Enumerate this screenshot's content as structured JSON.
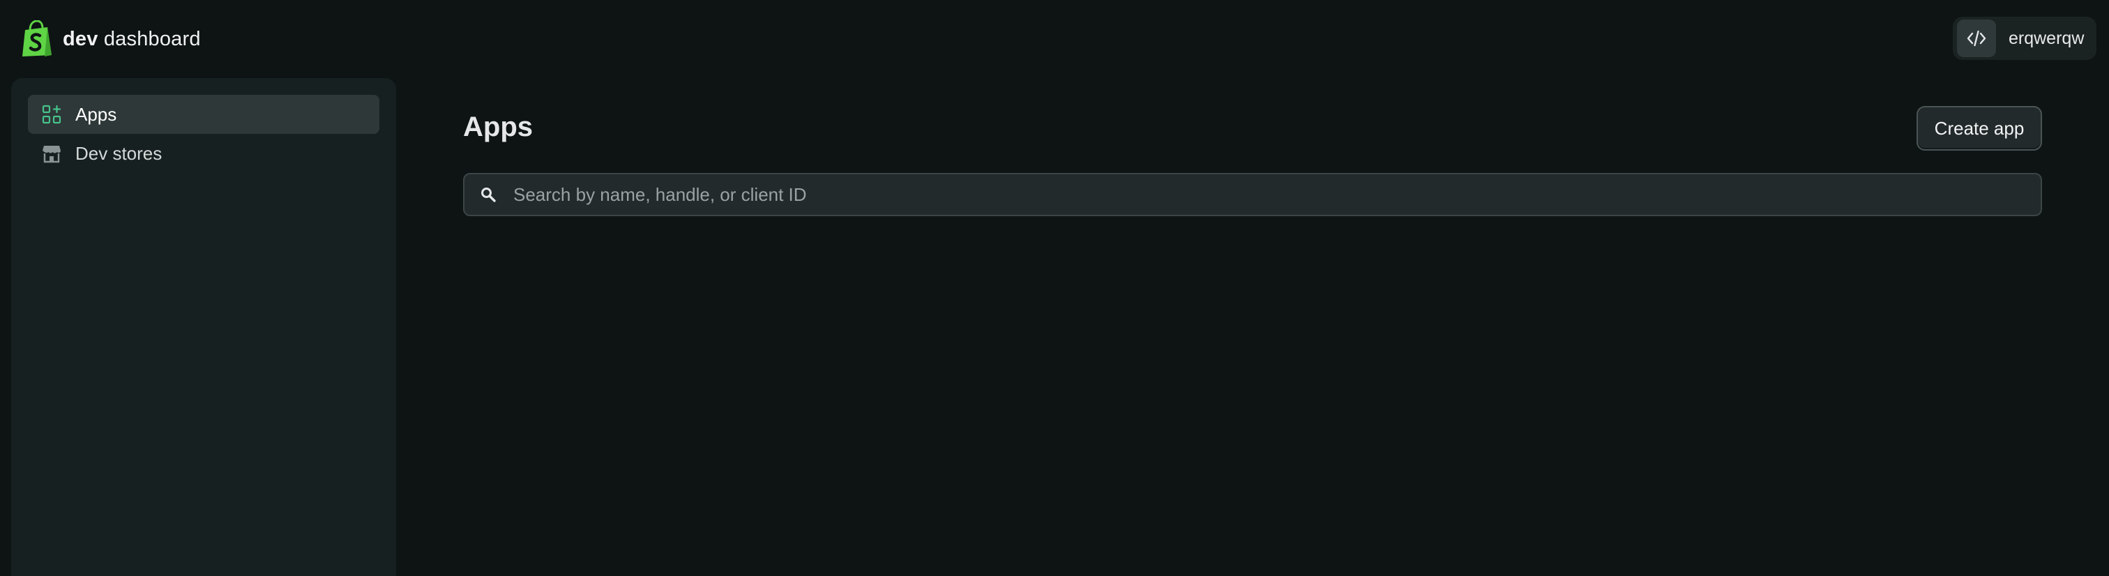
{
  "brand": {
    "bold": "dev",
    "rest": "dashboard",
    "logo_icon": "shopify-bag-icon",
    "accent_color": "#5fd445"
  },
  "user": {
    "name": "erqwerqw",
    "icon": "code-icon"
  },
  "sidebar": {
    "items": [
      {
        "label": "Apps",
        "icon": "apps-grid-icon",
        "active": true
      },
      {
        "label": "Dev stores",
        "icon": "store-icon",
        "active": false
      }
    ]
  },
  "main": {
    "title": "Apps",
    "create_button_label": "Create app",
    "search": {
      "placeholder": "Search by name, handle, or client ID",
      "value": ""
    }
  }
}
